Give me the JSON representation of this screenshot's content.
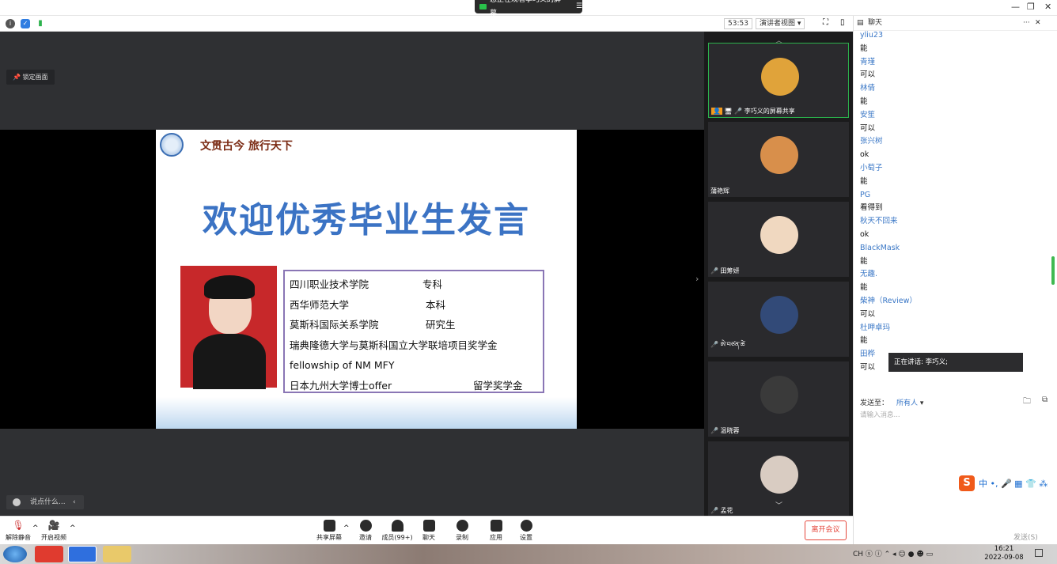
{
  "top": {
    "share_banner": "您正在观看李巧义的屏幕",
    "timer": "53:53",
    "view_mode": "演讲者视图"
  },
  "stage": {
    "pin_label": "锁定画面",
    "say_placeholder": "说点什么..."
  },
  "slide": {
    "motto": "文贯古今 旅行天下",
    "title": "欢迎优秀毕业生发言",
    "rows": [
      {
        "left": "四川职业技术学院",
        "right": "专科"
      },
      {
        "left": "西华师范大学",
        "right": "本科"
      },
      {
        "left": "莫斯科国际关系学院",
        "right": "研究生"
      },
      {
        "left": "瑞典隆德大学与莫斯科国立大学联培项目奖学金",
        "right": ""
      },
      {
        "left": "fellowship of NM MFY",
        "right": ""
      },
      {
        "left": "日本九州大学博士offer",
        "right": "留学奖学金"
      }
    ]
  },
  "gallery": {
    "tiles": [
      {
        "name": "李巧义的屏幕共享",
        "avatar": "#e0a33a"
      },
      {
        "name": "蒲艳辉",
        "avatar": "#d88f4b"
      },
      {
        "name": "田筹妍",
        "avatar": "#f0d8c0"
      },
      {
        "name": "ཨེ་བཙན་ཚེ",
        "avatar": "#324a78"
      },
      {
        "name": "温晓蓉",
        "avatar": "#3a3a3a"
      },
      {
        "name": "孟花",
        "avatar": "#d9ccc2"
      }
    ]
  },
  "chat": {
    "title": "聊天",
    "messages": [
      {
        "name": "yliu23",
        "text": "能"
      },
      {
        "name": "青瑾",
        "text": "可以"
      },
      {
        "name": "林倩",
        "text": "能"
      },
      {
        "name": "安笙",
        "text": "可以"
      },
      {
        "name": "张兴树",
        "text": "ok"
      },
      {
        "name": "小萄子",
        "text": "能"
      },
      {
        "name": "PG",
        "text": "看得到"
      },
      {
        "name": "秋天不回来",
        "text": "ok"
      },
      {
        "name": "BlackMask",
        "text": "能"
      },
      {
        "name": "无趣.",
        "text": "能"
      },
      {
        "name": "柴神（Review）",
        "text": "可以"
      },
      {
        "name": "杜呷卓玛",
        "text": "能"
      },
      {
        "name": "田桦",
        "text": "可以"
      }
    ],
    "speaking": "正在讲话: 李巧义;",
    "send_to_label": "发送至：",
    "send_to_value": "所有人",
    "input_placeholder": "请输入消息...",
    "send_button": "发送(S)"
  },
  "bottom": {
    "mute": "解除静音",
    "video": "开启视频",
    "share": "共享屏幕",
    "invite": "邀请",
    "members": "成员(99+)",
    "chat": "聊天",
    "record": "录制",
    "apps": "应用",
    "settings": "设置",
    "leave": "离开会议"
  },
  "taskbar": {
    "time": "16:21",
    "date": "2022-09-08"
  },
  "colors": {
    "accent_green": "#2bb24c",
    "leave_red": "#e5473c",
    "chat_name_blue": "#3a77c6",
    "slide_title_blue": "#3b73c4"
  }
}
